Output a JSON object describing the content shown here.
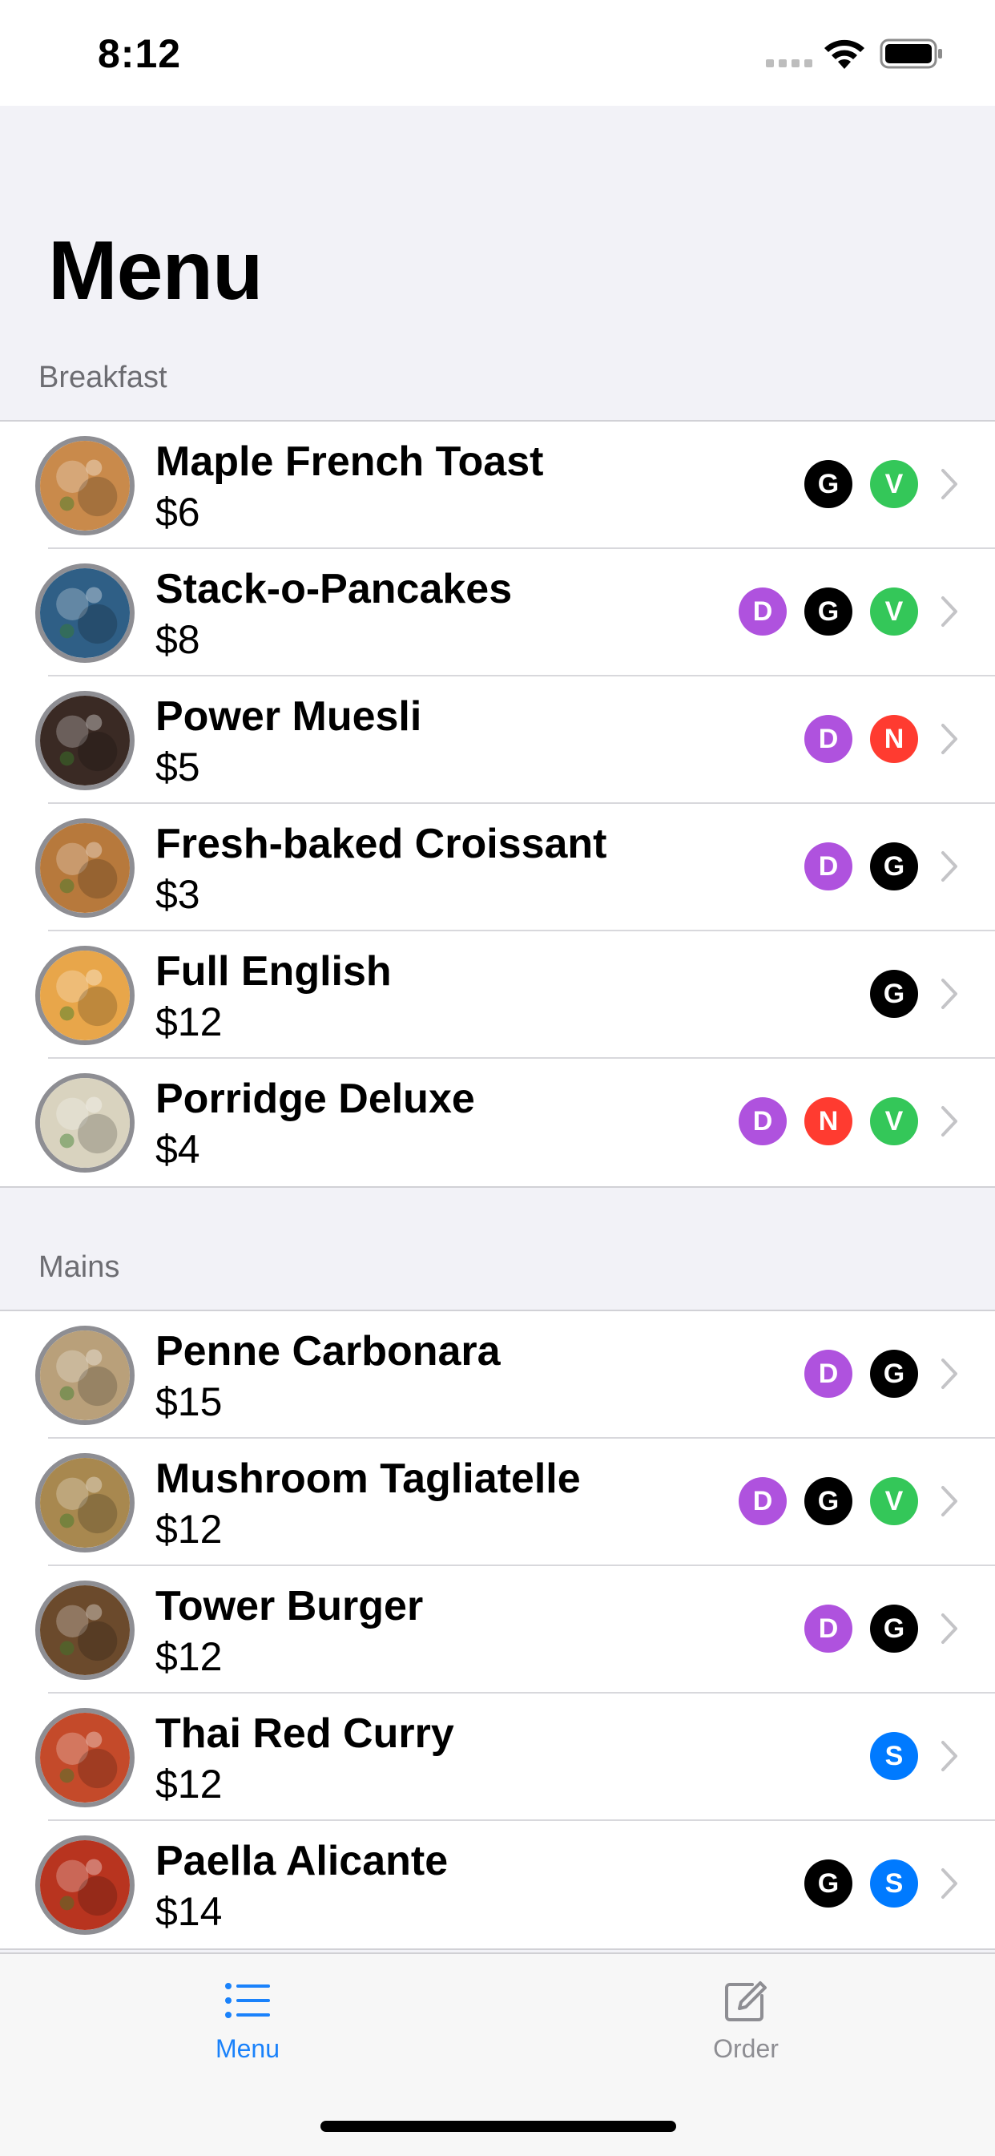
{
  "status_bar": {
    "time": "8:12"
  },
  "title": "Menu",
  "sections": [
    {
      "header": "Breakfast",
      "items": [
        {
          "name": "Maple French Toast",
          "price": "$6",
          "badges": [
            "G",
            "V"
          ],
          "thumb_color": "#c98a4b"
        },
        {
          "name": "Stack-o-Pancakes",
          "price": "$8",
          "badges": [
            "D",
            "G",
            "V"
          ],
          "thumb_color": "#2f5f86"
        },
        {
          "name": "Power Muesli",
          "price": "$5",
          "badges": [
            "D",
            "N"
          ],
          "thumb_color": "#3a2a24"
        },
        {
          "name": "Fresh-baked Croissant",
          "price": "$3",
          "badges": [
            "D",
            "G"
          ],
          "thumb_color": "#b7793c"
        },
        {
          "name": "Full English",
          "price": "$12",
          "badges": [
            "G"
          ],
          "thumb_color": "#e8a64a"
        },
        {
          "name": "Porridge Deluxe",
          "price": "$4",
          "badges": [
            "D",
            "N",
            "V"
          ],
          "thumb_color": "#d9d3bf"
        }
      ]
    },
    {
      "header": "Mains",
      "items": [
        {
          "name": "Penne Carbonara",
          "price": "$15",
          "badges": [
            "D",
            "G"
          ],
          "thumb_color": "#b9a07a"
        },
        {
          "name": "Mushroom Tagliatelle",
          "price": "$12",
          "badges": [
            "D",
            "G",
            "V"
          ],
          "thumb_color": "#a8884f"
        },
        {
          "name": "Tower Burger",
          "price": "$12",
          "badges": [
            "D",
            "G"
          ],
          "thumb_color": "#6b4a2c"
        },
        {
          "name": "Thai Red Curry",
          "price": "$12",
          "badges": [
            "S"
          ],
          "thumb_color": "#c44a2a"
        },
        {
          "name": "Paella Alicante",
          "price": "$14",
          "badges": [
            "G",
            "S"
          ],
          "thumb_color": "#b8341f"
        }
      ]
    }
  ],
  "badge_colors": {
    "D": "#af52de",
    "G": "#000000",
    "V": "#34c759",
    "N": "#ff3b30",
    "S": "#007aff"
  },
  "tab_bar": {
    "tabs": [
      {
        "label": "Menu",
        "icon": "list-icon",
        "active": true
      },
      {
        "label": "Order",
        "icon": "compose-icon",
        "active": false
      }
    ],
    "active_color": "#1a82fb",
    "inactive_color": "#8e8e93"
  }
}
